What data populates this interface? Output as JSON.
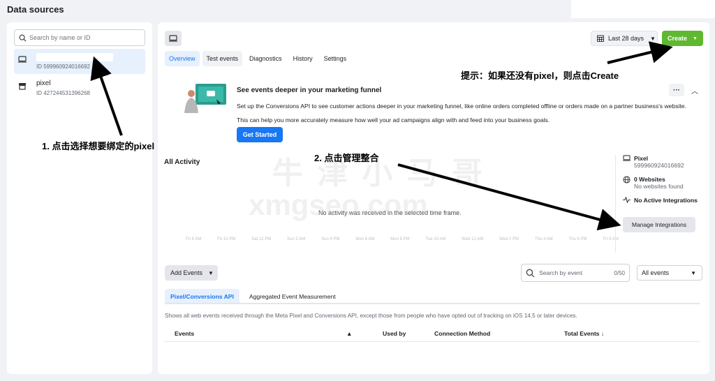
{
  "page": {
    "title": "Data sources"
  },
  "left": {
    "search_placeholder": "Search by name or ID",
    "sources": [
      {
        "name": "",
        "id": "ID 599960924016692",
        "icon": "desktop-icon"
      },
      {
        "name": "pixel",
        "id": "ID 427244531396268",
        "icon": "store-icon"
      }
    ]
  },
  "toolbar": {
    "date_range": "Last 28 days",
    "create": "Create"
  },
  "tabs": [
    "Overview",
    "Test events",
    "Diagnostics",
    "History",
    "Settings"
  ],
  "promo": {
    "title": "See events deeper in your marketing funnel",
    "text1": "Set up the Conversions API to see customer actions deeper in your marketing funnel, like online orders completed offline or orders made on a partner business's website.",
    "text2": "This can help you more accurately measure how well your ad campaigns align with and feed into your business goals.",
    "button": "Get Started"
  },
  "activity": {
    "title": "All Activity",
    "empty": "No activity was received in the selected time frame.",
    "ticks": [
      "Fri 8 AM",
      "Fri 10 PM",
      "Sat 12 PM",
      "Sun 2 AM",
      "Sun 4 PM",
      "Mon 6 AM",
      "Mon 8 PM",
      "Tue 10 AM",
      "Wed 12 AM",
      "Wed 2 PM",
      "Thu 4 AM",
      "Thu 6 PM",
      "Fri 8 AM"
    ]
  },
  "stats": {
    "pixel_label": "Pixel",
    "pixel_id": "599960924016692",
    "websites_label": "0 Websites",
    "websites_sub": "No websites found",
    "integrations_label": "No Active Integrations",
    "manage_button": "Manage Integrations"
  },
  "events": {
    "add_events": "Add Events",
    "search_placeholder": "Search by event",
    "search_count": "0/50",
    "filter": "All events",
    "subtabs": [
      "Pixel/Conversions API",
      "Aggregated Event Measurement"
    ],
    "disclaimer": "Shows all web events received through the Meta Pixel and Conversions API, except those from people who have opted out of tracking on iOS 14.5 or later devices.",
    "columns": [
      "Events",
      "Used by",
      "Connection Method",
      "Total Events ↓"
    ]
  },
  "annotations": {
    "step1": "1. 点击选择想要绑定的pixel",
    "step2": "2. 点击管理整合",
    "hint": "提示：如果还没有pixel，则点击Create"
  },
  "watermark": {
    "line1": "牛 津 小 马 哥",
    "line2": "xmgseo.com"
  },
  "colors": {
    "accent": "#1877f2",
    "create": "#5fb830",
    "selected_bg": "#e7f0fd"
  }
}
